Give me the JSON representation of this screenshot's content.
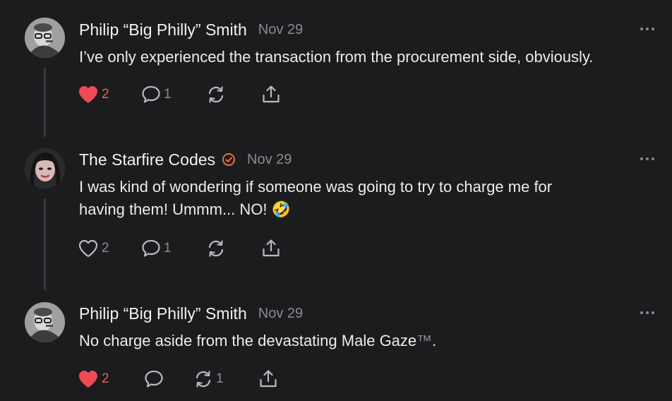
{
  "posts": [
    {
      "author": "Philip “Big Philly” Smith",
      "verified": false,
      "date": "Nov 29",
      "text": "I’ve only experienced the transaction from the procurement side, obviously.",
      "text_lines": [
        "I’ve only experienced the transaction from the procurement side, obviously."
      ],
      "likes": "2",
      "liked": true,
      "comments": "1",
      "restacks": "",
      "avatar": "bw-man-glasses"
    },
    {
      "author": "The Starfire Codes",
      "verified": true,
      "date": "Nov 29",
      "text_lines": [
        "I was kind of wondering if someone was going to try to charge me for",
        "having them! Ummm... NO! 🤣"
      ],
      "likes": "2",
      "liked": false,
      "comments": "1",
      "restacks": "",
      "avatar": "woman-dark-hair"
    },
    {
      "author": "Philip “Big Philly” Smith",
      "verified": false,
      "date": "Nov 29",
      "text_main": "No charge aside from the devastating Male Gaze",
      "text_tm": "™",
      "text_end": ".",
      "likes": "2",
      "liked": true,
      "comments": "",
      "restacks": "1",
      "avatar": "bw-man-glasses"
    }
  ],
  "colors": {
    "background": "#1b1c1e",
    "like_active": "#ef4b55",
    "verified_accent": "#f26b3a",
    "muted": "#8a8b8f"
  },
  "icons": {
    "like": "heart-icon",
    "comment": "speech-bubble-icon",
    "restack": "restack-arrows-icon",
    "share": "share-upload-icon",
    "more": "ellipsis-icon",
    "verified": "verified-check-icon"
  }
}
